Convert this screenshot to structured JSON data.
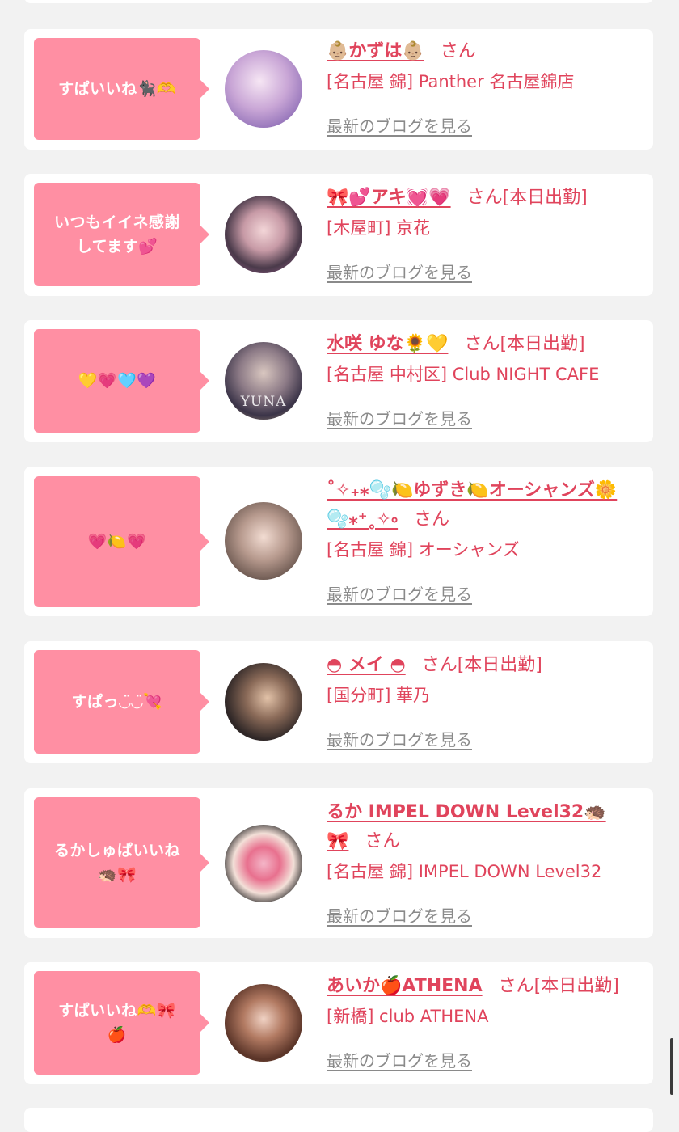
{
  "blog_link_label": "最新のブログを見る",
  "cards": [
    {
      "bubble": "すぱいいね🐈‍⬛🫶",
      "name": "👶🏼かずは👶🏼",
      "san": "さん",
      "shop": "[名古屋 錦] Panther 名古屋錦店"
    },
    {
      "bubble": "いつもイイネ感謝\nしてます💕",
      "name": "🎀💕アキ💓💗",
      "san": "さん[本日出勤]",
      "shop": "[木屋町] 京花"
    },
    {
      "bubble": "💛💗🩵💜",
      "name": "水咲 ゆな🌻💛",
      "san": "さん[本日出勤]",
      "shop": "[名古屋 中村区] Club NIGHT CAFE",
      "avatar_text": "YUNA"
    },
    {
      "bubble": "💗🍋💗",
      "name": "˚✧₊⁎🫧🍋ゆずき🍋オーシャンズ🌼\n🫧⁎⁺˳✧༚",
      "san": "さん",
      "shop": "[名古屋 錦] オーシャンズ"
    },
    {
      "bubble": "すぱっ◡̈◡̈💘",
      "name": "◓ メイ ◓",
      "san": "さん[本日出勤]",
      "shop": "[国分町] 華乃"
    },
    {
      "bubble": "るかしゅぱいいね\n🦔🎀",
      "name": "るか IMPEL DOWN Level32🦔\n🎀",
      "san": "さん",
      "shop": "[名古屋 錦] IMPEL DOWN Level32"
    },
    {
      "bubble": "すぱいいね🫶🎀\n🍎",
      "name": "あいか🍎ATHENA",
      "san": "さん[本日出勤]",
      "shop": "[新橋] club ATHENA"
    }
  ],
  "colors": {
    "bubble": "#ff8fa3",
    "accent_text": "#e0445c",
    "link_gray": "#8a8a8a",
    "page_bg": "#f2f2f2"
  }
}
